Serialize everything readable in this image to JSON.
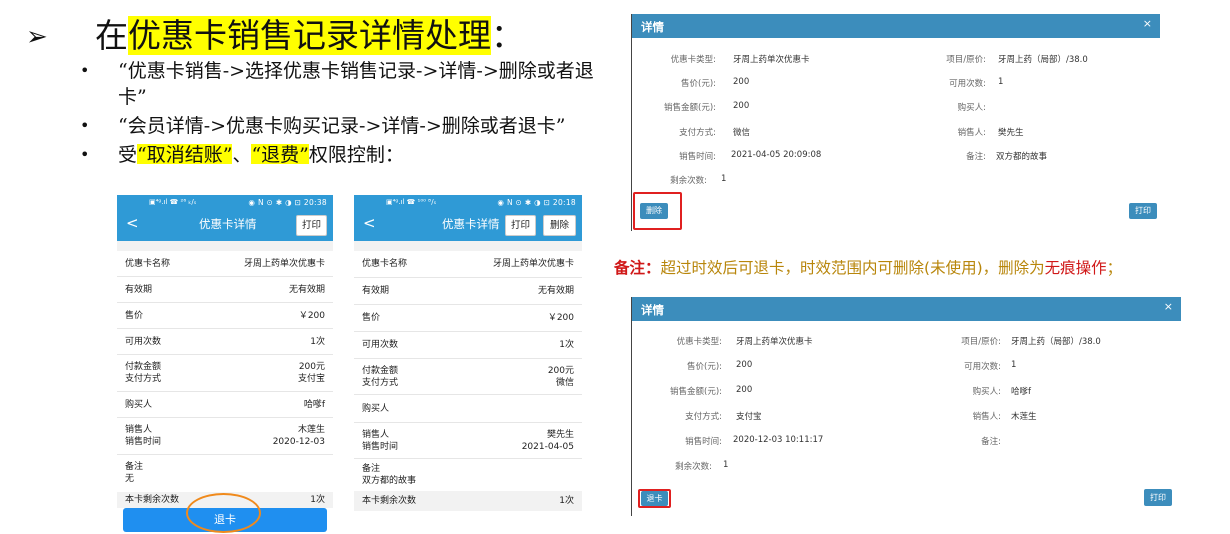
{
  "slide": {
    "arrow": "➢",
    "title_hl": "优惠卡销售记录详情处理",
    "title_pre": "在",
    "title_post": "：",
    "bullets": [
      "“优惠卡销售->选择优惠卡销售记录->详情->删除或者退卡”",
      "“会员详情->优惠卡购买记录->详情->删除或者退卡”"
    ],
    "bullet3_pre": "受",
    "bullet3_hl1": "“取消结账”",
    "bullet3_mid": "、",
    "bullet3_hl2": "“退费”",
    "bullet3_post": "权限控制："
  },
  "phone1": {
    "status_left": "▣⁴ᵍ.ıl ☎ ²⁶ ₖ/ₛ",
    "status_right": "◉ N ⊙ ✱ ◑ ⊡ 20:38",
    "back": "<",
    "title": "优惠卡详情",
    "print": "打印",
    "rows": [
      {
        "l": [
          "优惠卡名称"
        ],
        "r": [
          "牙周上药单次优惠卡"
        ]
      },
      {
        "l": [
          "有效期"
        ],
        "r": [
          "无有效期"
        ]
      },
      {
        "l": [
          "售价"
        ],
        "r": [
          "￥200"
        ]
      },
      {
        "l": [
          "可用次数"
        ],
        "r": [
          "1次"
        ]
      },
      {
        "l": [
          "付款金额",
          "支付方式"
        ],
        "r": [
          "200元",
          "支付宝"
        ]
      },
      {
        "l": [
          "购买人"
        ],
        "r": [
          "哈嗲f"
        ]
      },
      {
        "l": [
          "销售人",
          "销售时间"
        ],
        "r": [
          "木莲生",
          "2020-12-03"
        ]
      },
      {
        "l": [
          "备注",
          "无"
        ],
        "r": [
          ""
        ]
      }
    ],
    "remain_label": "本卡剩余次数",
    "remain_value": "1次",
    "refund_button": "退卡"
  },
  "phone2": {
    "status_left": "▣⁴ᵍ.ıl ☎ ¹⁰⁰ ᴮ/ₛ",
    "status_right": "◉ N ⊙ ✱ ◑ ⊡ 20:18",
    "back": "<",
    "title": "优惠卡详情",
    "print": "打印",
    "delete": "删除",
    "rows": [
      {
        "l": [
          "优惠卡名称"
        ],
        "r": [
          "牙周上药单次优惠卡"
        ]
      },
      {
        "l": [
          "有效期"
        ],
        "r": [
          "无有效期"
        ]
      },
      {
        "l": [
          "售价"
        ],
        "r": [
          "￥200"
        ]
      },
      {
        "l": [
          "可用次数"
        ],
        "r": [
          "1次"
        ]
      },
      {
        "l": [
          "付款金额",
          "支付方式"
        ],
        "r": [
          "200元",
          "微信"
        ]
      },
      {
        "l": [
          "购买人"
        ],
        "r": [
          ""
        ]
      },
      {
        "l": [
          "销售人",
          "销售时间"
        ],
        "r": [
          "樊先生",
          "2021-04-05"
        ]
      },
      {
        "l": [
          "备注",
          "双方都的故事"
        ],
        "r": [
          ""
        ]
      }
    ],
    "remain_label": "本卡剩余次数",
    "remain_value": "1次"
  },
  "panel1": {
    "title": "详情",
    "close": "×",
    "fields": [
      {
        "label": "优惠卡类型:",
        "value": "牙周上药单次优惠卡"
      },
      {
        "label": "项目/原价:",
        "value": "牙周上药（局部）/38.0"
      },
      {
        "label": "售价(元):",
        "value": "200"
      },
      {
        "label": "可用次数:",
        "value": "1"
      },
      {
        "label": "销售金额(元):",
        "value": "200"
      },
      {
        "label": "购买人:",
        "value": ""
      },
      {
        "label": "支付方式:",
        "value": "微信"
      },
      {
        "label": "销售人:",
        "value": "樊先生"
      },
      {
        "label": "销售时间:",
        "value": "2021-04-05 20:09:08"
      },
      {
        "label": "备注:",
        "value": "双方都的故事"
      },
      {
        "label": "剩余次数:",
        "value": "1"
      }
    ],
    "action_button": "删除",
    "print_button": "打印"
  },
  "remark": {
    "label": "备注：",
    "text1": "超过时效后可退卡，时效范围内可删除(未使用)，删除为",
    "text_red": "无痕操作",
    "text2": "；"
  },
  "panel2": {
    "title": "详情",
    "close": "×",
    "fields": [
      {
        "label": "优惠卡类型:",
        "value": "牙周上药单次优惠卡"
      },
      {
        "label": "项目/原价:",
        "value": "牙周上药（局部）/38.0"
      },
      {
        "label": "售价(元):",
        "value": "200"
      },
      {
        "label": "可用次数:",
        "value": "1"
      },
      {
        "label": "销售金额(元):",
        "value": "200"
      },
      {
        "label": "购买人:",
        "value": "哈嗲f"
      },
      {
        "label": "支付方式:",
        "value": "支付宝"
      },
      {
        "label": "销售人:",
        "value": "木莲生"
      },
      {
        "label": "销售时间:",
        "value": "2020-12-03 10:11:17"
      },
      {
        "label": "备注:",
        "value": ""
      },
      {
        "label": "剩余次数:",
        "value": "1"
      }
    ],
    "action_button": "退卡",
    "print_button": "打印"
  },
  "colors": {
    "highlight": "#ffff00",
    "phone_header": "#2f9ad6",
    "panel_header": "#3c8dbc",
    "annotation_red": "#e02020",
    "annotation_orange": "#f08a1c",
    "remark_text": "#b8860b"
  }
}
